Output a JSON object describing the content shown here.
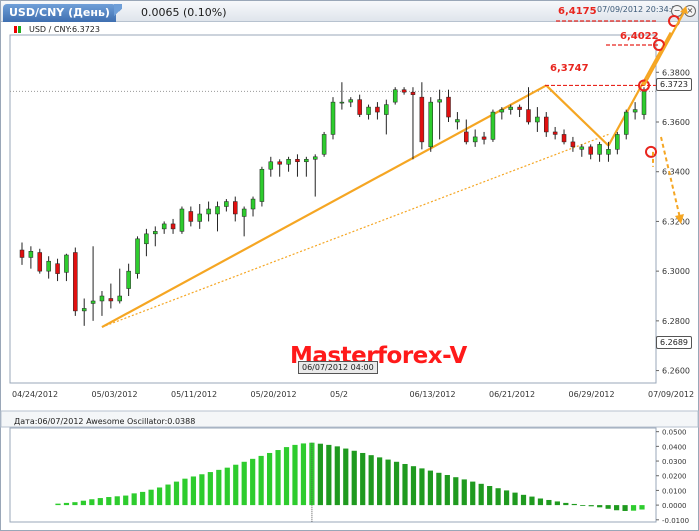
{
  "window": {
    "tab_title": "USD/CNY (День)",
    "change": "0.0065 (0.10%)",
    "datetime": "07/09/2012 20:34:26",
    "minimize_glyph": "−",
    "close_glyph": "×"
  },
  "main_legend": "USD / CNY:6.3723",
  "watermark": "Masterforex-V",
  "current_price_tag": "6.3723",
  "low_price_tag": "6.2689",
  "crosshair_date": "06/07/2012 04:00",
  "annotations": {
    "target1": "6,4175",
    "target2": "6,4022",
    "swing_high": "6,3747"
  },
  "ao_legend": "Дата:06/07/2012 Awesome Oscillator:0.0388",
  "colors": {
    "bull_candle": "#2ecc2e",
    "bear_candle": "#e01010",
    "trend_line": "#f5a623",
    "annotation_red": "#e8251e",
    "tab_blue": "#4a7dbf"
  },
  "chart_data": [
    {
      "type": "candlestick",
      "title": "USD / CNY",
      "y_tick_labels": [
        "6.2600",
        "6.2800",
        "6.3000",
        "6.3200",
        "6.3400",
        "6.3600",
        "6.3800"
      ],
      "x_tick_labels": [
        "04/24/2012",
        "05/03/2012",
        "05/11/2012",
        "05/20/2012",
        "05/2",
        "06/13/2012",
        "06/21/2012",
        "06/29/2012",
        "07/09/2012"
      ],
      "ylim": [
        6.255,
        6.395
      ],
      "grid": false,
      "candles": [
        {
          "o": 6.3085,
          "h": 6.3115,
          "l": 6.3025,
          "c": 6.3055
        },
        {
          "o": 6.3055,
          "h": 6.31,
          "l": 6.301,
          "c": 6.308
        },
        {
          "o": 6.3075,
          "h": 6.309,
          "l": 6.299,
          "c": 6.3
        },
        {
          "o": 6.3,
          "h": 6.306,
          "l": 6.297,
          "c": 6.304
        },
        {
          "o": 6.303,
          "h": 6.305,
          "l": 6.296,
          "c": 6.299
        },
        {
          "o": 6.2995,
          "h": 6.307,
          "l": 6.296,
          "c": 6.3065
        },
        {
          "o": 6.3075,
          "h": 6.3095,
          "l": 6.282,
          "c": 6.284
        },
        {
          "o": 6.284,
          "h": 6.289,
          "l": 6.278,
          "c": 6.285
        },
        {
          "o": 6.287,
          "h": 6.31,
          "l": 6.28,
          "c": 6.288
        },
        {
          "o": 6.288,
          "h": 6.292,
          "l": 6.282,
          "c": 6.29
        },
        {
          "o": 6.289,
          "h": 6.295,
          "l": 6.285,
          "c": 6.288
        },
        {
          "o": 6.288,
          "h": 6.301,
          "l": 6.287,
          "c": 6.29
        },
        {
          "o": 6.293,
          "h": 6.303,
          "l": 6.29,
          "c": 6.3
        },
        {
          "o": 6.299,
          "h": 6.314,
          "l": 6.297,
          "c": 6.313
        },
        {
          "o": 6.311,
          "h": 6.317,
          "l": 6.306,
          "c": 6.315
        },
        {
          "o": 6.315,
          "h": 6.318,
          "l": 6.31,
          "c": 6.316
        },
        {
          "o": 6.317,
          "h": 6.32,
          "l": 6.315,
          "c": 6.319
        },
        {
          "o": 6.319,
          "h": 6.321,
          "l": 6.315,
          "c": 6.317
        },
        {
          "o": 6.316,
          "h": 6.326,
          "l": 6.315,
          "c": 6.325
        },
        {
          "o": 6.324,
          "h": 6.326,
          "l": 6.318,
          "c": 6.32
        },
        {
          "o": 6.32,
          "h": 6.327,
          "l": 6.317,
          "c": 6.323
        },
        {
          "o": 6.323,
          "h": 6.328,
          "l": 6.32,
          "c": 6.325
        },
        {
          "o": 6.323,
          "h": 6.328,
          "l": 6.316,
          "c": 6.326
        },
        {
          "o": 6.326,
          "h": 6.329,
          "l": 6.324,
          "c": 6.328
        },
        {
          "o": 6.328,
          "h": 6.33,
          "l": 6.32,
          "c": 6.323
        },
        {
          "o": 6.322,
          "h": 6.326,
          "l": 6.314,
          "c": 6.325
        },
        {
          "o": 6.325,
          "h": 6.33,
          "l": 6.322,
          "c": 6.329
        },
        {
          "o": 6.328,
          "h": 6.342,
          "l": 6.326,
          "c": 6.341
        },
        {
          "o": 6.341,
          "h": 6.346,
          "l": 6.338,
          "c": 6.344
        },
        {
          "o": 6.344,
          "h": 6.345,
          "l": 6.338,
          "c": 6.343
        },
        {
          "o": 6.343,
          "h": 6.346,
          "l": 6.34,
          "c": 6.345
        },
        {
          "o": 6.345,
          "h": 6.347,
          "l": 6.338,
          "c": 6.344
        },
        {
          "o": 6.344,
          "h": 6.346,
          "l": 6.338,
          "c": 6.345
        },
        {
          "o": 6.345,
          "h": 6.347,
          "l": 6.33,
          "c": 6.346
        },
        {
          "o": 6.347,
          "h": 6.356,
          "l": 6.346,
          "c": 6.355
        },
        {
          "o": 6.355,
          "h": 6.37,
          "l": 6.353,
          "c": 6.368
        },
        {
          "o": 6.368,
          "h": 6.376,
          "l": 6.365,
          "c": 6.368
        },
        {
          "o": 6.368,
          "h": 6.37,
          "l": 6.366,
          "c": 6.369
        },
        {
          "o": 6.369,
          "h": 6.371,
          "l": 6.362,
          "c": 6.363
        },
        {
          "o": 6.363,
          "h": 6.367,
          "l": 6.361,
          "c": 6.366
        },
        {
          "o": 6.366,
          "h": 6.368,
          "l": 6.361,
          "c": 6.364
        },
        {
          "o": 6.363,
          "h": 6.369,
          "l": 6.355,
          "c": 6.367
        },
        {
          "o": 6.368,
          "h": 6.374,
          "l": 6.367,
          "c": 6.373
        },
        {
          "o": 6.373,
          "h": 6.374,
          "l": 6.371,
          "c": 6.372
        },
        {
          "o": 6.372,
          "h": 6.374,
          "l": 6.345,
          "c": 6.371
        },
        {
          "o": 6.37,
          "h": 6.376,
          "l": 6.349,
          "c": 6.352
        },
        {
          "o": 6.35,
          "h": 6.37,
          "l": 6.348,
          "c": 6.368
        },
        {
          "o": 6.368,
          "h": 6.373,
          "l": 6.353,
          "c": 6.369
        },
        {
          "o": 6.37,
          "h": 6.373,
          "l": 6.36,
          "c": 6.362
        },
        {
          "o": 6.36,
          "h": 6.364,
          "l": 6.357,
          "c": 6.361
        },
        {
          "o": 6.356,
          "h": 6.361,
          "l": 6.351,
          "c": 6.352
        },
        {
          "o": 6.352,
          "h": 6.357,
          "l": 6.35,
          "c": 6.354
        },
        {
          "o": 6.354,
          "h": 6.356,
          "l": 6.351,
          "c": 6.353
        },
        {
          "o": 6.353,
          "h": 6.365,
          "l": 6.352,
          "c": 6.364
        },
        {
          "o": 6.364,
          "h": 6.366,
          "l": 6.361,
          "c": 6.365
        },
        {
          "o": 6.365,
          "h": 6.367,
          "l": 6.363,
          "c": 6.366
        },
        {
          "o": 6.366,
          "h": 6.367,
          "l": 6.362,
          "c": 6.365
        },
        {
          "o": 6.365,
          "h": 6.374,
          "l": 6.359,
          "c": 6.36
        },
        {
          "o": 6.36,
          "h": 6.366,
          "l": 6.356,
          "c": 6.362
        },
        {
          "o": 6.362,
          "h": 6.364,
          "l": 6.354,
          "c": 6.356
        },
        {
          "o": 6.356,
          "h": 6.358,
          "l": 6.353,
          "c": 6.355
        },
        {
          "o": 6.355,
          "h": 6.357,
          "l": 6.351,
          "c": 6.352
        },
        {
          "o": 6.352,
          "h": 6.354,
          "l": 6.348,
          "c": 6.35
        },
        {
          "o": 6.349,
          "h": 6.351,
          "l": 6.346,
          "c": 6.35
        },
        {
          "o": 6.35,
          "h": 6.351,
          "l": 6.345,
          "c": 6.347
        },
        {
          "o": 6.347,
          "h": 6.352,
          "l": 6.344,
          "c": 6.351
        },
        {
          "o": 6.347,
          "h": 6.352,
          "l": 6.344,
          "c": 6.349
        },
        {
          "o": 6.349,
          "h": 6.356,
          "l": 6.347,
          "c": 6.355
        },
        {
          "o": 6.355,
          "h": 6.365,
          "l": 6.353,
          "c": 6.364
        },
        {
          "o": 6.364,
          "h": 6.368,
          "l": 6.361,
          "c": 6.365
        },
        {
          "o": 6.363,
          "h": 6.374,
          "l": 6.361,
          "c": 6.3723
        }
      ],
      "trend_lines": [
        {
          "from": {
            "i": 9,
            "y": 6.2775
          },
          "to": {
            "i": 66,
            "y": 6.355
          },
          "style": "dotted"
        },
        {
          "from": {
            "i": 9,
            "y": 6.2775
          },
          "to": {
            "i": 59,
            "y": 6.3747
          },
          "style": "solid"
        },
        {
          "from": {
            "i": 59,
            "y": 6.3747
          },
          "to": {
            "i": 66,
            "y": 6.3505
          },
          "style": "solid"
        },
        {
          "from": {
            "i": 66,
            "y": 6.3505
          },
          "to": {
            "i": 73,
            "y": 6.396
          },
          "style": "solid"
        }
      ],
      "horizontal_levels": [
        6.4175,
        6.4022,
        6.3747
      ]
    },
    {
      "type": "bar",
      "title": "Awesome Oscillator",
      "y_tick_labels": [
        "0.0500",
        "0.0400",
        "0.0300",
        "0.0200",
        "0.0100",
        "0.0000",
        "-0.0100"
      ],
      "ylim": [
        -0.0115,
        0.0525
      ],
      "values": [
        0.001,
        0.0015,
        0.002,
        0.003,
        0.004,
        0.0048,
        0.0055,
        0.006,
        0.0065,
        0.008,
        0.009,
        0.0105,
        0.012,
        0.014,
        0.016,
        0.018,
        0.0195,
        0.021,
        0.0225,
        0.024,
        0.0255,
        0.0275,
        0.0295,
        0.0315,
        0.0335,
        0.0355,
        0.0375,
        0.0395,
        0.041,
        0.042,
        0.0425,
        0.0418,
        0.041,
        0.04,
        0.0385,
        0.037,
        0.0355,
        0.034,
        0.0325,
        0.031,
        0.0295,
        0.028,
        0.0265,
        0.025,
        0.0235,
        0.022,
        0.0205,
        0.019,
        0.0175,
        0.016,
        0.0145,
        0.013,
        0.0115,
        0.01,
        0.0085,
        0.007,
        0.0058,
        0.0045,
        0.0035,
        0.0025,
        0.0015,
        0.0008,
        0.0,
        -0.0008,
        -0.0015,
        -0.0025,
        -0.0035,
        -0.004,
        -0.0038,
        -0.003
      ]
    }
  ]
}
